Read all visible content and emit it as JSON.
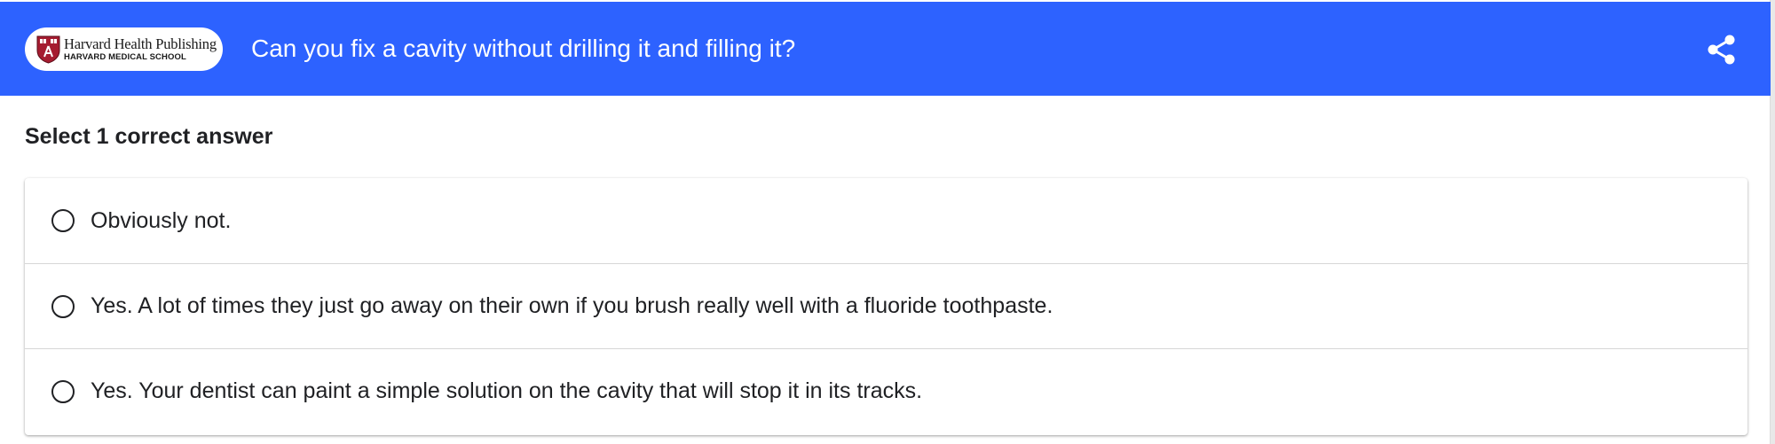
{
  "header": {
    "logo": {
      "line1": "Harvard Health Publishing",
      "line2": "HARVARD MEDICAL SCHOOL"
    },
    "title": "Can you fix a cavity without drilling it and filling it?",
    "share_icon": "share-icon"
  },
  "question": {
    "instruction": "Select 1 correct answer",
    "options": [
      {
        "label": "Obviously not.",
        "selected": false
      },
      {
        "label": "Yes. A lot of times they just go away on their own if you brush really well with a fluoride toothpaste.",
        "selected": false
      },
      {
        "label": "Yes. Your dentist can paint a simple solution on the cavity that will stop it in its tracks.",
        "selected": false
      }
    ]
  },
  "colors": {
    "header_bg": "#2d62ff",
    "text": "#202124",
    "shield_red": "#a51c30"
  }
}
